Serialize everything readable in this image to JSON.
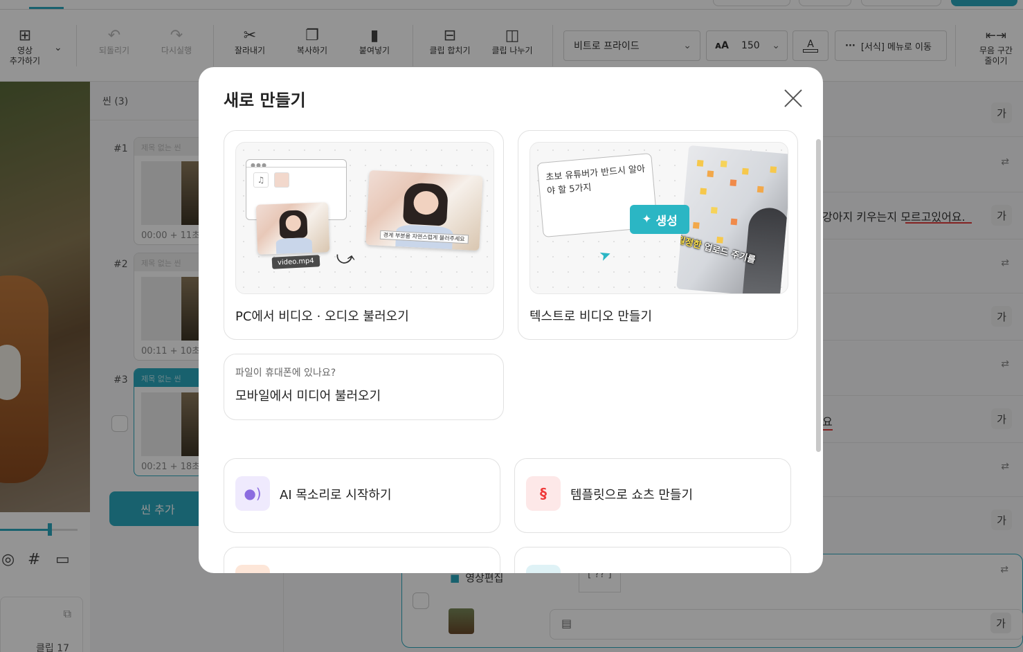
{
  "toolbar": {
    "add_video": "영상\n추가하기",
    "undo": "되돌리기",
    "redo": "다시실행",
    "cut": "잘라내기",
    "copy": "복사하기",
    "paste": "붙여넣기",
    "merge_clip": "클립 합치기",
    "split_clip": "클립 나누기",
    "font_name": "비트로 프라이드",
    "font_size": "150",
    "text_color_letter": "A",
    "format_menu": "[서식] 메뉴로 이동",
    "silence_reduce": "무음 구간\n줄이기"
  },
  "scenes": {
    "title": "씬 (3)",
    "items": [
      {
        "num": "#1",
        "name": "제목 없는 씬",
        "duration": "00:00 + 11초"
      },
      {
        "num": "#2",
        "name": "제목 없는 씬",
        "duration": "00:11 + 10초"
      },
      {
        "num": "#3",
        "name": "제목 없는 씬",
        "duration": "00:21 + 18초"
      }
    ],
    "add_scene": "씬 추가"
  },
  "left": {
    "clip_count": "클립 17"
  },
  "script": {
    "ga": "가",
    "line1": "강아지 키우는지 모르고있어요.",
    "line1_err": "모르고있어요",
    "line2_tail": "요",
    "edit_label": "영상편집",
    "edit_tag": "[ ?? ]"
  },
  "modal": {
    "title": "새로 만들기",
    "cards": {
      "pc": {
        "label": "PC에서 비디오 · 오디오 불러오기",
        "file_tag": "video.mp4",
        "caption": "경계 부분을 자연스럽게 블러주세요"
      },
      "text": {
        "label": "텍스트로 비디오 만들기",
        "prompt": "초보 유튜버가 반드시 알아야 할 5가지",
        "gen_button": "생성",
        "board_caption_hl": "일정한",
        "board_caption": " 업로드 주기를"
      },
      "mobile": {
        "hint": "파일이 휴대폰에 있나요?",
        "label": "모바일에서 미디어 불러오기"
      },
      "ai_voice": {
        "label": "AI 목소리로 시작하기"
      },
      "shorts": {
        "label": "템플릿으로 쇼츠 만들기"
      }
    },
    "colors": {
      "accent": "#2aa8bd",
      "ai_voice_bg": "#efeafd",
      "ai_voice_fg": "#8b6ce0",
      "shorts_bg": "#fde8e8",
      "shorts_fg": "#ef3b3b"
    }
  }
}
